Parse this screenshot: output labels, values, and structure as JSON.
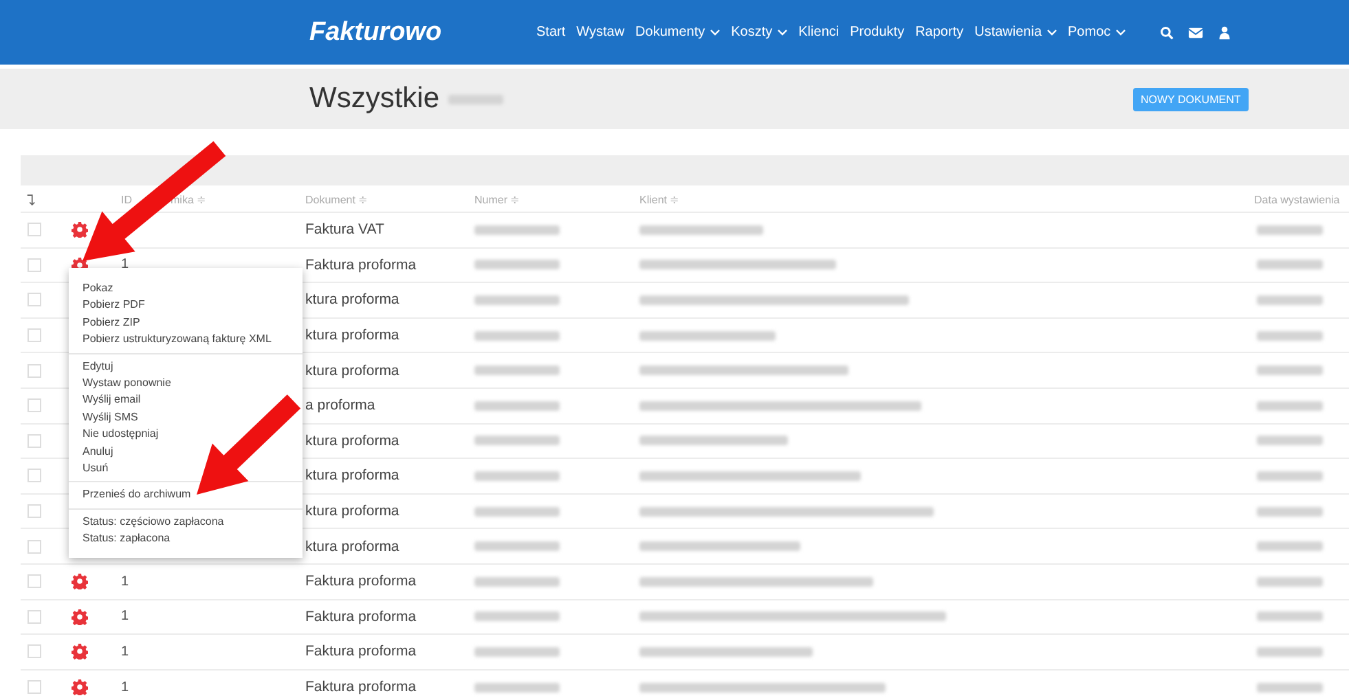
{
  "navbar": {
    "logo": "Fakturowo",
    "items": [
      {
        "label": "Start",
        "dropdown": false
      },
      {
        "label": "Wystaw",
        "dropdown": false
      },
      {
        "label": "Dokumenty",
        "dropdown": true
      },
      {
        "label": "Koszty",
        "dropdown": true
      },
      {
        "label": "Klienci",
        "dropdown": false
      },
      {
        "label": "Produkty",
        "dropdown": false
      },
      {
        "label": "Raporty",
        "dropdown": false
      },
      {
        "label": "Ustawienia",
        "dropdown": true
      },
      {
        "label": "Pomoc",
        "dropdown": true
      }
    ]
  },
  "page_header": {
    "title": "Wszystkie",
    "new_button": "NOWY DOKUMENT"
  },
  "table": {
    "columns": {
      "id_start": "ID",
      "id_end": "mika ≑",
      "document": "Dokument ≑",
      "number": "Numer ≑",
      "client": "Klient ≑",
      "date": "Data wystawienia"
    },
    "rows": [
      {
        "checked": false,
        "gear": true,
        "id": "",
        "document": "Faktura VAT"
      },
      {
        "checked": false,
        "gear": true,
        "id": "1",
        "document": "Faktura proforma"
      },
      {
        "checked": false,
        "id": "",
        "document": "ktura proforma"
      },
      {
        "checked": false,
        "id": "",
        "document": "ktura proforma"
      },
      {
        "checked": false,
        "id": "",
        "document": "ktura proforma"
      },
      {
        "checked": false,
        "id": "",
        "document": "a proforma"
      },
      {
        "checked": false,
        "id": "",
        "document": "ktura proforma"
      },
      {
        "checked": false,
        "id": "",
        "document": "ktura proforma"
      },
      {
        "checked": false,
        "id": "",
        "document": "ktura proforma"
      },
      {
        "checked": false,
        "id": "",
        "document": "ktura proforma"
      },
      {
        "checked": false,
        "gear": true,
        "id": "1",
        "document": "Faktura proforma"
      },
      {
        "checked": false,
        "gear": true,
        "id": "1",
        "document": "Faktura proforma"
      },
      {
        "checked": false,
        "gear": true,
        "id": "1",
        "document": "Faktura proforma"
      },
      {
        "checked": false,
        "gear": true,
        "id": "1",
        "document": "Faktura proforma"
      }
    ]
  },
  "context_menu": {
    "groups": [
      [
        "Pokaz",
        "Pobierz PDF",
        "Pobierz ZIP",
        "Pobierz ustrukturyzowaną fakturę XML"
      ],
      [
        "Edytuj",
        "Wystaw ponownie",
        "Wyślij email",
        "Wyślij SMS",
        "Nie udostępniaj",
        "Anuluj",
        "Usuń"
      ],
      [
        "Przenieś do archiwum"
      ],
      [
        "Status: częściowo zapłacona",
        "Status: zapłacona"
      ]
    ]
  }
}
